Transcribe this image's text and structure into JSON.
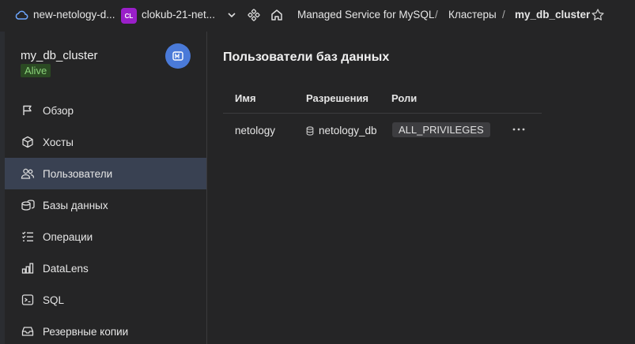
{
  "header": {
    "cloud_name": "new-netology-d...",
    "folder_badge": "CL",
    "folder_name": "clokub-21-net...",
    "breadcrumb_service": "Managed Service for MySQL",
    "breadcrumb_separator": "/",
    "breadcrumb_clusters": "Кластеры",
    "breadcrumb_current": "my_db_cluster"
  },
  "sidebar": {
    "cluster_name": "my_db_cluster",
    "status": "Alive",
    "items": [
      {
        "label": "Обзор",
        "icon": "flag-icon"
      },
      {
        "label": "Хосты",
        "icon": "cube-icon"
      },
      {
        "label": "Пользователи",
        "icon": "users-icon",
        "active": true
      },
      {
        "label": "Базы данных",
        "icon": "databases-icon"
      },
      {
        "label": "Операции",
        "icon": "operations-icon"
      },
      {
        "label": "DataLens",
        "icon": "datalens-icon"
      },
      {
        "label": "SQL",
        "icon": "terminal-icon"
      },
      {
        "label": "Резервные копии",
        "icon": "backup-icon"
      }
    ]
  },
  "main": {
    "title": "Пользователи баз данных",
    "columns": [
      "Имя",
      "Разрешения",
      "Роли"
    ],
    "rows": [
      {
        "name": "netology",
        "permission": "netology_db",
        "role": "ALL_PRIVILEGES"
      }
    ]
  },
  "colors": {
    "active_nav": "#394152",
    "status_bg": "#2b4a23",
    "status_text": "#8bd37a",
    "folder_badge": "#9a1fc9",
    "avatar": "#4a7ad8"
  }
}
